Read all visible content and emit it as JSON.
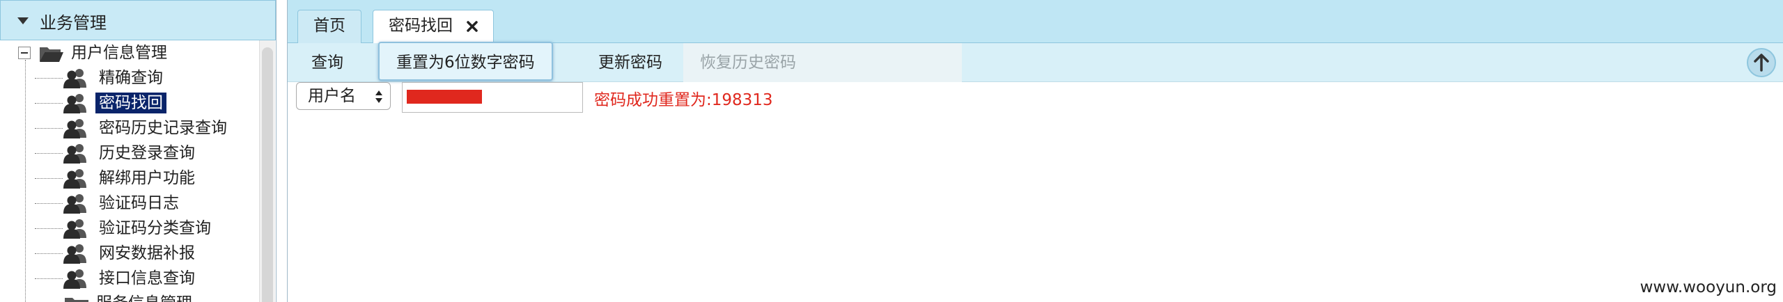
{
  "sidebar": {
    "section_title": "业务管理",
    "folder_label": "用户信息管理",
    "items": [
      {
        "label": "精确查询"
      },
      {
        "label": "密码找回"
      },
      {
        "label": "密码历史记录查询"
      },
      {
        "label": "历史登录查询"
      },
      {
        "label": "解绑用户功能"
      },
      {
        "label": "验证码日志"
      },
      {
        "label": "验证码分类查询"
      },
      {
        "label": "网安数据补报"
      },
      {
        "label": "接口信息查询"
      }
    ],
    "next_folder_label": "服务信息管理",
    "selected_index": 1
  },
  "tabs": {
    "home": "首页",
    "active": "密码找回"
  },
  "toolbar": {
    "query": "查询",
    "reset6": "重置为6位数字密码",
    "update": "更新密码",
    "restore": "恢复历史密码"
  },
  "form": {
    "select_value": "用户名",
    "result_message": "密码成功重置为:198313"
  },
  "watermark": "www.wooyun.org",
  "colors": {
    "header_bg": "#c9eaf6",
    "tab_strip_bg": "#bfe6f4",
    "toolbar_bg": "#d8f0f8",
    "selected_bg": "#0a246a",
    "message_red": "#e0281e"
  }
}
